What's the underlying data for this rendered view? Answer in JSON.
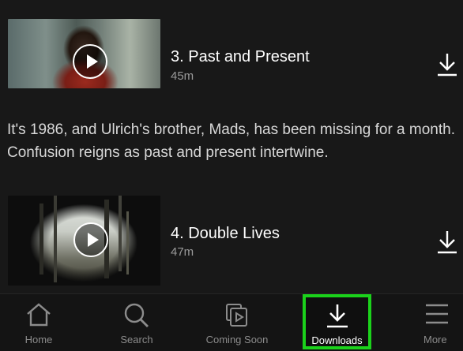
{
  "episodes": [
    {
      "title": "3. Past and Present",
      "duration": "45m",
      "icon": "download-icon"
    },
    {
      "title": "4. Double Lives",
      "duration": "47m",
      "icon": "download-icon"
    }
  ],
  "episode3_description": "It's 1986, and Ulrich's brother, Mads, has been missing for a month. Confusion reigns as past and present intertwine.",
  "nav": {
    "home": "Home",
    "search": "Search",
    "coming_soon": "Coming Soon",
    "downloads": "Downloads",
    "more": "More",
    "active": "downloads",
    "highlight_color": "#1bd21b"
  }
}
